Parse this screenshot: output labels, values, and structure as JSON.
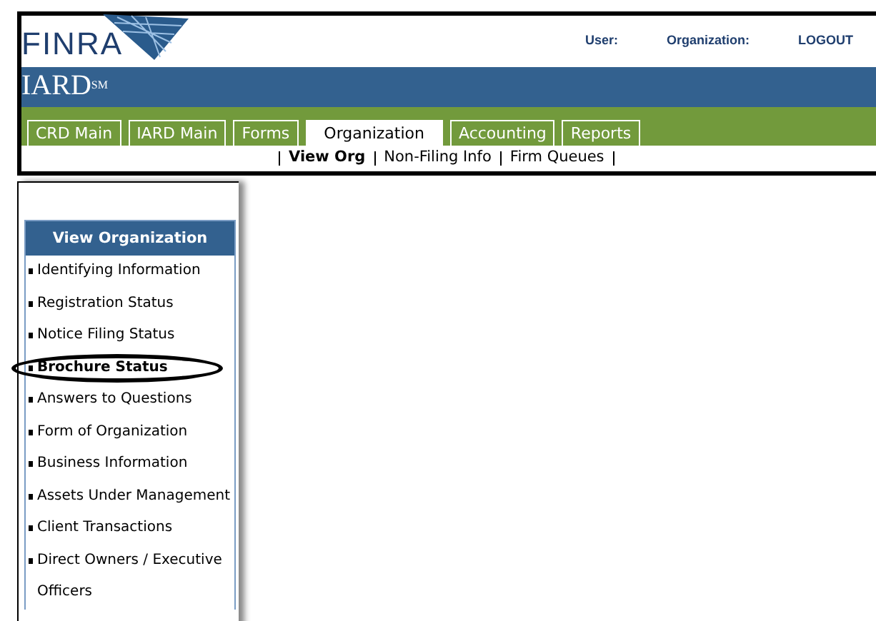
{
  "header": {
    "logo": "FINRA",
    "links": [
      "User:",
      "Organization:",
      "LOGOUT"
    ],
    "app_title": "IARD$^{SM}$"
  },
  "tabs": [
    {
      "label": "CRD Main",
      "selected": false
    },
    {
      "label": "IARD Main",
      "selected": false
    },
    {
      "label": "Forms",
      "selected": false
    },
    {
      "label": "Organization",
      "selected": true
    },
    {
      "label": "Accounting",
      "selected": false
    },
    {
      "label": "Reports",
      "selected": false
    }
  ],
  "subnav": [
    {
      "label": "View Org",
      "selected": true
    },
    {
      "label": "Non-Filing Info",
      "selected": false
    },
    {
      "label": "Firm Queues",
      "selected": false
    }
  ],
  "sidebar": {
    "title": "View Organization",
    "items": [
      {
        "label": "Identifying Information",
        "selected": false,
        "circled": false
      },
      {
        "label": "Registration Status",
        "selected": false,
        "circled": false
      },
      {
        "label": "Notice Filing Status",
        "selected": false,
        "circled": false
      },
      {
        "label": "Brochure Status",
        "selected": true,
        "circled": true
      },
      {
        "label": "Answers to Questions",
        "selected": false,
        "circled": false
      },
      {
        "label": "Form of Organization",
        "selected": false,
        "circled": false
      },
      {
        "label": "Business Information",
        "selected": false,
        "circled": false
      },
      {
        "label": "Assets Under Management",
        "selected": false,
        "circled": false
      },
      {
        "label": "Client Transactions",
        "selected": false,
        "circled": false
      },
      {
        "label": "Direct Owners / Executive Officers",
        "selected": false,
        "circled": false
      }
    ]
  }
}
